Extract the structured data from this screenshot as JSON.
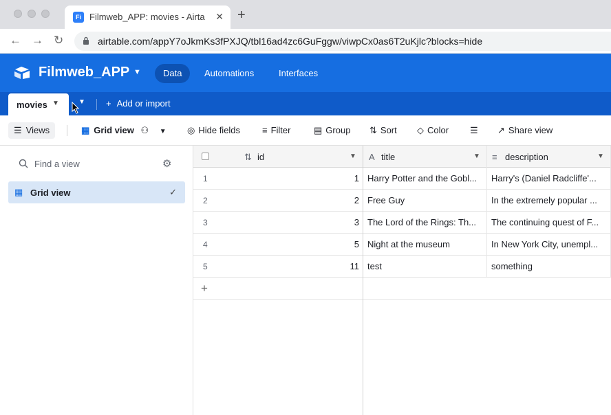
{
  "browser": {
    "tab_title": "Filmweb_APP: movies - Airtable",
    "tab_favicon": "Fi",
    "url": "airtable.com/appY7oJkmKs3fPXJQ/tbl16ad4zc6GuFggw/viwpCx0as6T2uKjlc?blocks=hide"
  },
  "app": {
    "base_name": "Filmweb_APP",
    "nav": [
      "Data",
      "Automations",
      "Interfaces"
    ]
  },
  "tables": {
    "active_table": "movies",
    "add_import": "Add or import"
  },
  "toolbar": {
    "views": "Views",
    "grid_view": "Grid view",
    "hide_fields": "Hide fields",
    "filter": "Filter",
    "group": "Group",
    "sort": "Sort",
    "color": "Color",
    "share_view": "Share view"
  },
  "sidebar": {
    "find_placeholder": "Find a view",
    "views": [
      {
        "label": "Grid view",
        "selected": true
      }
    ]
  },
  "grid": {
    "columns": [
      "id",
      "title",
      "description"
    ],
    "rows": [
      {
        "row": "1",
        "id": "1",
        "title": "Harry Potter and the Gobl...",
        "description": "Harry's (Daniel Radcliffe'..."
      },
      {
        "row": "2",
        "id": "2",
        "title": "Free Guy",
        "description": "In the extremely popular ..."
      },
      {
        "row": "3",
        "id": "3",
        "title": "The Lord of the Rings: Th...",
        "description": "The continuing quest of F..."
      },
      {
        "row": "4",
        "id": "5",
        "title": "Night at the museum",
        "description": "In New York City, unempl..."
      },
      {
        "row": "5",
        "id": "11",
        "title": "test",
        "description": "something"
      }
    ],
    "add_row": "+"
  },
  "colors": {
    "brand_blue": "#166ee1",
    "table_bar": "#0f5bc9",
    "selected_view": "#d8e6f7"
  }
}
